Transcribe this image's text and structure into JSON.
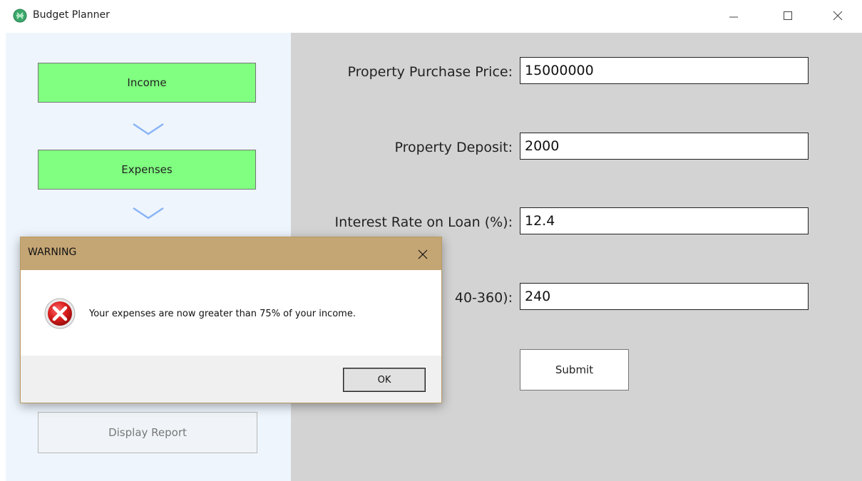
{
  "window": {
    "title": "Budget Planner"
  },
  "steps": {
    "income_label": "Income",
    "expenses_label": "Expenses",
    "display_report_label": "Display Report"
  },
  "form": {
    "purchase_price_label": "Property Purchase Price:",
    "purchase_price_value": "15000000",
    "deposit_label": "Property Deposit:",
    "deposit_value": "2000",
    "interest_label": "Interest Rate on Loan (%):",
    "interest_value": "12.4",
    "months_label_visible": "40-360):",
    "months_value": "240",
    "submit_label": "Submit"
  },
  "dialog": {
    "title": "WARNING",
    "message": "Your expenses are now greater than 75% of your income.",
    "ok_label": "OK"
  },
  "colors": {
    "step_complete": "#80ff80",
    "left_pane_bg": "#eef5fd",
    "right_pane_bg": "#d3d3d3",
    "dialog_title_bg": "#c4a574",
    "chevron": "#8ab4f8"
  },
  "icons": {
    "app": "budget-planner-app-icon",
    "error": "error-x-icon",
    "minimize": "minimize-icon",
    "maximize": "maximize-icon",
    "close": "close-icon"
  }
}
